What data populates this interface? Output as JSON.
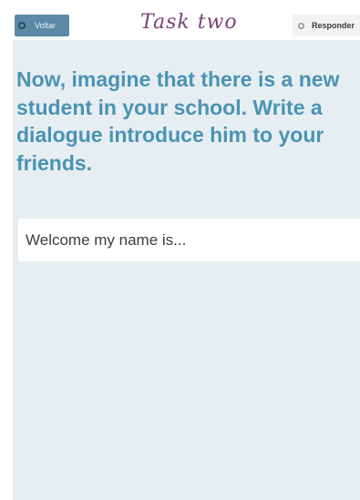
{
  "header": {
    "back_label": "Voltar",
    "title": "Task two",
    "reply_label": "Responder"
  },
  "prompt": {
    "text": "Now, imagine that there is a new student in your school. Write a dialogue introduce him to your friends."
  },
  "answer": {
    "value": "Welcome my name is..."
  },
  "icons": {
    "back": "back-icon",
    "reply": "radio-icon"
  },
  "colors": {
    "accent_button": "#5b89a6",
    "title_ink": "#7d3f7c",
    "prompt_text": "#4a93b4",
    "panel_background": "#e7eef2"
  }
}
